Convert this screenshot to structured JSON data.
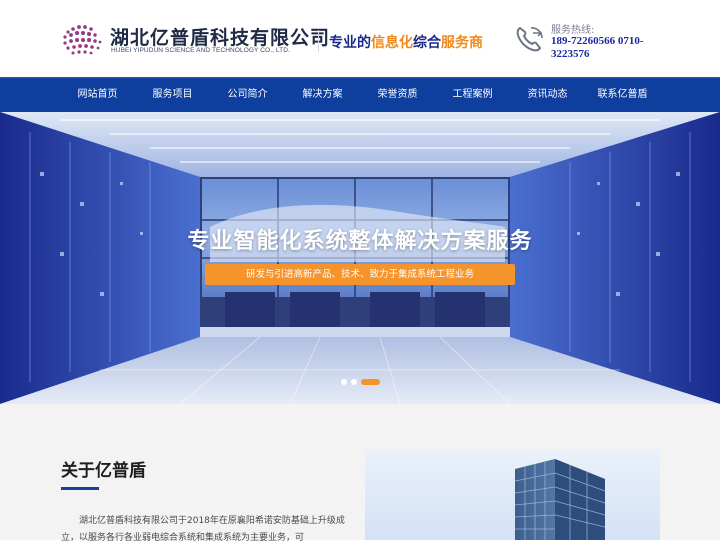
{
  "header": {
    "company_cn": "湖北亿普盾科技有限公司",
    "company_en": "HUBEI YIPUDUN SCIENCE AND TECHNOLOGY CO., LTD.",
    "slogan_part1": "专业的",
    "slogan_part2": "信息化",
    "slogan_part3": "综合",
    "slogan_part4": "服务商",
    "hotline_label": "服务热线:",
    "hotline_number": "189-72260566 0710-3223576",
    "logo_icon": "globe-logo-icon",
    "phone_icon": "phone-icon"
  },
  "nav": {
    "items": [
      {
        "label": "网站首页"
      },
      {
        "label": "服务项目"
      },
      {
        "label": "公司简介"
      },
      {
        "label": "解决方案"
      },
      {
        "label": "荣誉资质"
      },
      {
        "label": "工程案例"
      },
      {
        "label": "资讯动态"
      },
      {
        "label": "联系亿普盾"
      }
    ]
  },
  "banner": {
    "title": "专业智能化系统整体解决方案服务",
    "subtitle": "研发与引进高新产品、技术、致力于集成系统工程业务",
    "slides": 3,
    "active_slide": 3
  },
  "about": {
    "title": "关于亿普盾",
    "text": "湖北亿普盾科技有限公司于2018年在原襄阳希诺安防基础上升级成立，以服务各行各业弱电综合系统和集成系统为主要业务，可"
  },
  "colors": {
    "nav_bg": "#0f3f9e",
    "accent_orange": "#f4942a",
    "brand_blue": "#1a2a8a"
  }
}
